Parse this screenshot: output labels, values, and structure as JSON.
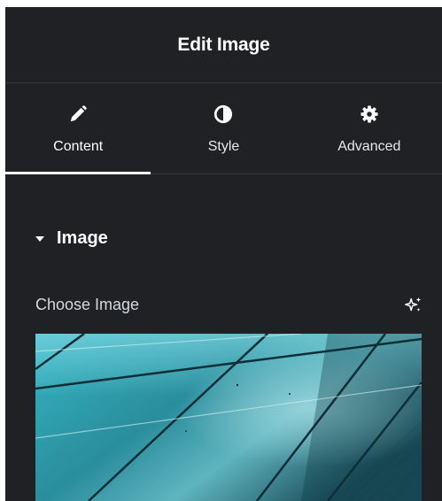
{
  "header": {
    "title": "Edit Image"
  },
  "tabs": [
    {
      "label": "Content",
      "icon": "pencil-icon",
      "active": true
    },
    {
      "label": "Style",
      "icon": "half-circle-icon",
      "active": false
    },
    {
      "label": "Advanced",
      "icon": "gear-icon",
      "active": false
    }
  ],
  "section": {
    "title": "Image",
    "expanded": true
  },
  "control": {
    "label": "Choose Image",
    "ai_icon": "sparkle-icon"
  },
  "colors": {
    "panel_bg": "#1f2124",
    "text": "#ffffff",
    "divider": "#34373b"
  }
}
